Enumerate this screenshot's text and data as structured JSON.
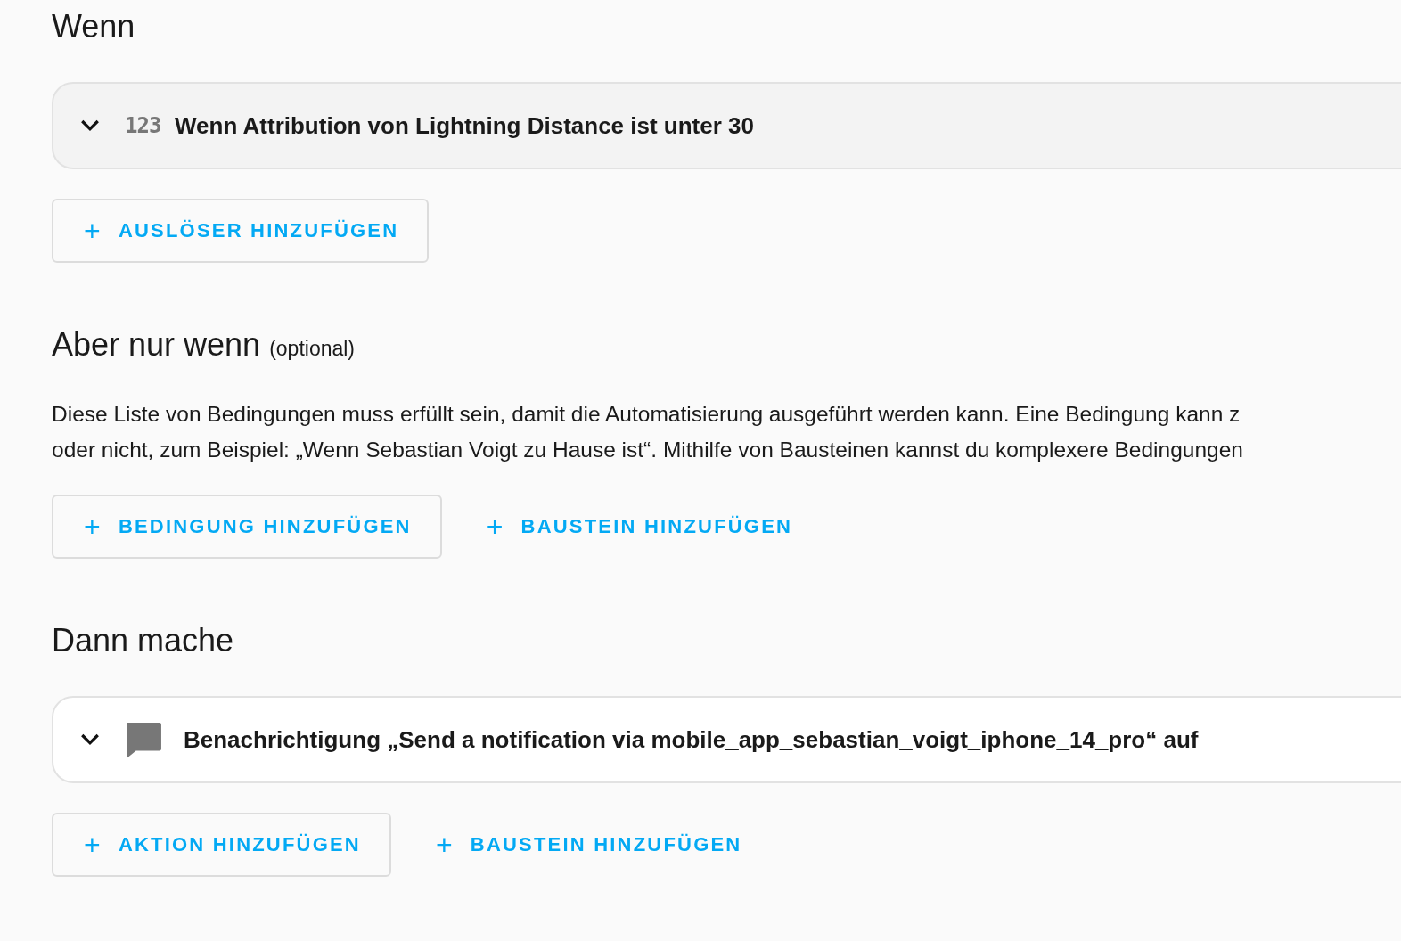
{
  "sections": [
    {
      "title": "Wenn",
      "items": [
        {
          "kind": "trigger",
          "icon": "123",
          "label": "Wenn Attribution von Lightning Distance ist unter 30",
          "expanded": false
        }
      ],
      "buttons": [
        {
          "label": "AUSLÖSER HINZUFÜGEN",
          "kind": "outlined",
          "icon": "+"
        }
      ]
    },
    {
      "title": "Aber nur wenn",
      "note": "(optional)",
      "description": [
        "Diese Liste von Bedingungen muss erfüllt sein, damit die Automatisierung ausgeführt werden kann. Eine Bedingung kann z",
        "oder nicht, zum Beispiel: „Wenn Sebastian Voigt zu Hause ist“. Mithilfe von Bausteinen kannst du komplexere Bedingungen"
      ],
      "buttons": [
        {
          "label": "BEDINGUNG HINZUFÜGEN",
          "kind": "outlined",
          "icon": "+"
        },
        {
          "label": "BAUSTEIN HINZUFÜGEN",
          "kind": "text",
          "icon": "+"
        }
      ]
    },
    {
      "title": "Dann mache",
      "items": [
        {
          "kind": "action",
          "label": "Benachrichtigung „Send a notification via mobile_app_sebastian_voigt_iphone_14_pro“ auf",
          "expanded": false
        }
      ],
      "buttons": [
        {
          "label": "AKTION HINZUFÜGEN",
          "kind": "outlined",
          "icon": "+"
        },
        {
          "label": "BAUSTEIN HINZUFÜGEN",
          "kind": "text",
          "icon": "+"
        }
      ]
    }
  ]
}
